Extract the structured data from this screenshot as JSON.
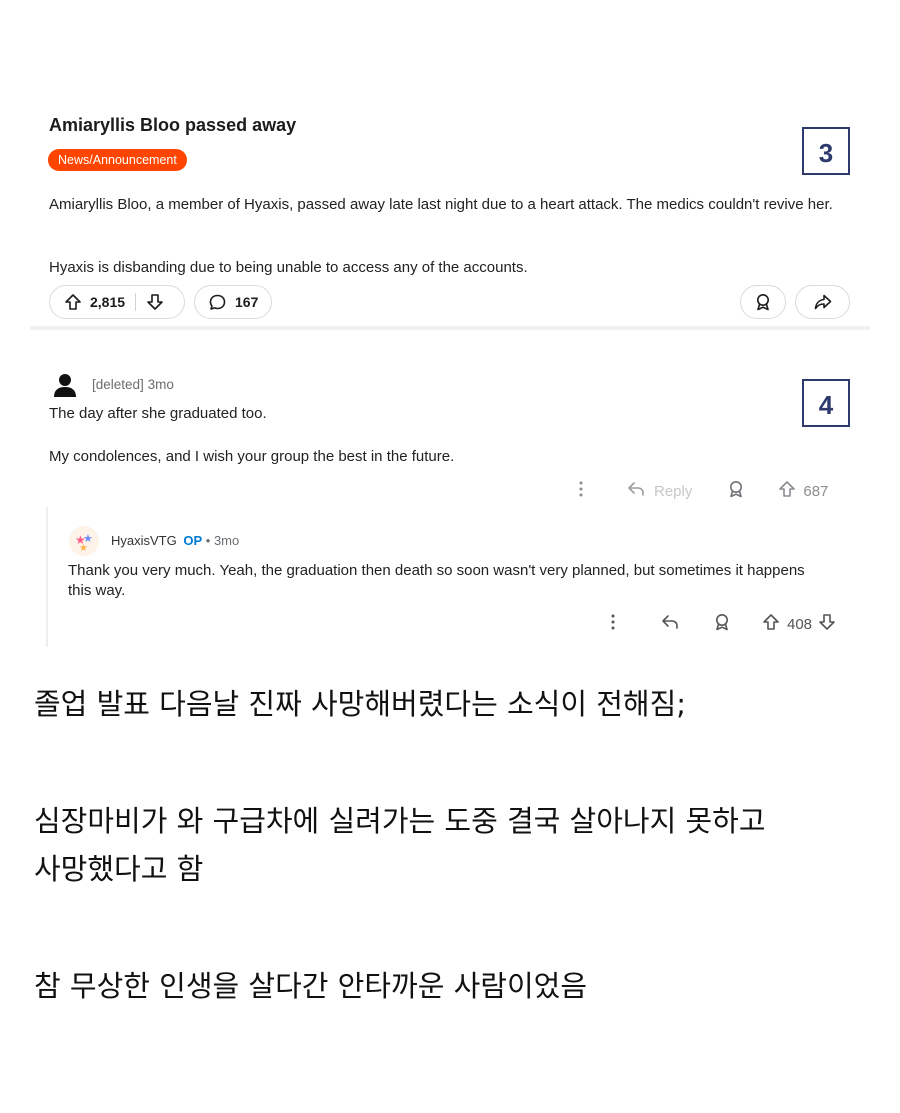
{
  "post": {
    "title": "Amiaryllis Bloo passed away",
    "flair": "News/Announcement",
    "body_1": "Amiaryllis Bloo, a member of Hyaxis, passed away late last night due to a heart attack. The medics couldn't revive her.",
    "body_2": "Hyaxis is disbanding due to being unable to access any of the accounts.",
    "upvotes": "2,815",
    "comments": "167",
    "box_label": "3"
  },
  "comment_1": {
    "author": "[deleted]",
    "age": "3mo",
    "line_1": "The day after she graduated too.",
    "line_2": "My condolences, and I wish your group the best in the future.",
    "reply_label": "Reply",
    "votes": "687",
    "box_label": "4"
  },
  "reply": {
    "author": "HyaxisVTG",
    "op_badge": "OP",
    "age": "• 3mo",
    "text": "Thank you very much. Yeah, the graduation then death so soon wasn't very planned, but sometimes it happens this way.",
    "votes": "408"
  },
  "caption": {
    "line_1": "졸업 발표 다음날 진짜 사망해버렸다는 소식이 전해짐;",
    "line_2a": "심장마비가 와 구급차에 실려가는 도중 결국 살아나지 못하고",
    "line_2b": "사망했다고 함",
    "line_3": "참 무상한 인생을 살다간 안타까운 사람이었음"
  },
  "colors": {
    "flair_bg": "#ff4500",
    "box_border": "#2d3a6b",
    "op_badge": "#0079d3"
  }
}
